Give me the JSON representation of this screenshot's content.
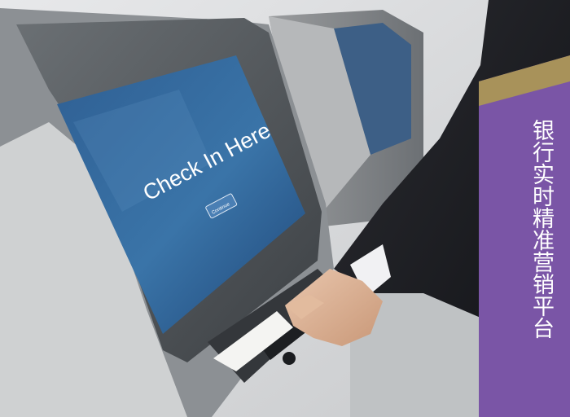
{
  "screen": {
    "headline": "Check In Here",
    "button_label": "Continue"
  },
  "banner": {
    "text": "银行实时精准营销平台"
  },
  "colors": {
    "banner_purple": "#7a55a6",
    "banner_gold": "#a8925a",
    "screen_blue": "#2c5d93",
    "kiosk_gray": "#55595d"
  }
}
